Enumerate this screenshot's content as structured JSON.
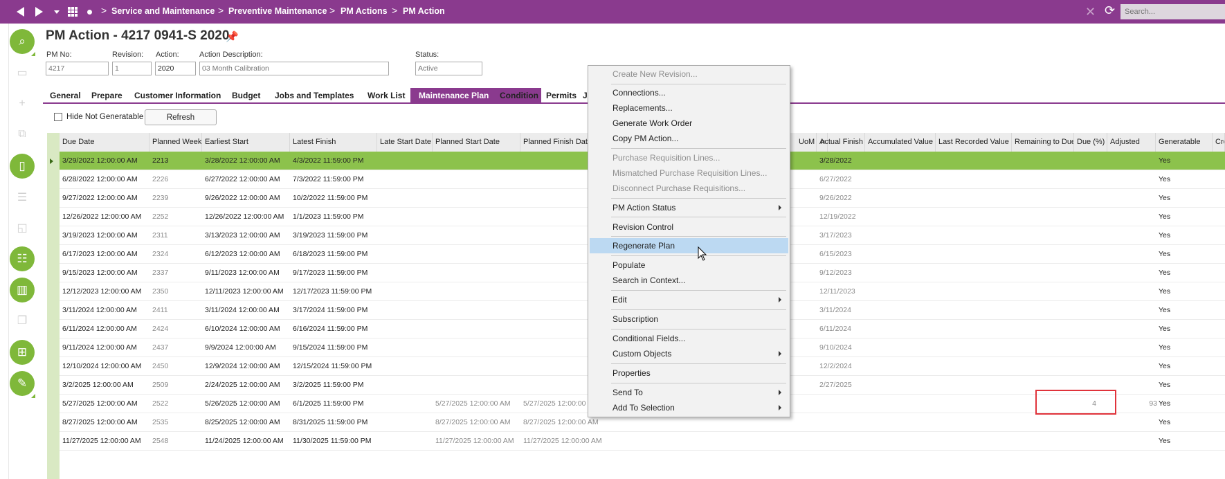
{
  "breadcrumb": [
    "Service and Maintenance",
    "Preventive Maintenance",
    "PM Actions",
    "PM Action"
  ],
  "search": {
    "placeholder": "Search..."
  },
  "page_title": "PM Action - 4217 0941-S 2020",
  "fields": {
    "pm_no": {
      "label": "PM No:",
      "value": "4217"
    },
    "revision": {
      "label": "Revision:",
      "value": "1"
    },
    "action": {
      "label": "Action:",
      "value": "2020"
    },
    "action_description": {
      "label": "Action Description:",
      "value": "03 Month Calibration"
    },
    "status": {
      "label": "Status:",
      "value": "Active"
    }
  },
  "tabs": [
    "General",
    "Prepare",
    "Customer Information",
    "Budget",
    "Jobs and Templates",
    "Work List",
    "Maintenance Plan",
    "Condition",
    "Permits",
    "J"
  ],
  "active_tab": "Maintenance Plan",
  "toolbar": {
    "hide_not_generatable": "Hide Not Generatable",
    "refresh": "Refresh"
  },
  "columns": [
    "Due Date",
    "Planned Week",
    "Earliest Start",
    "Latest Finish",
    "Late Start Date",
    "Planned Start Date",
    "Planned Finish Date",
    "n",
    "UoM",
    "Actual Finish",
    "Accumulated Value",
    "Last Recorded Value",
    "Remaining to Due",
    "Due (%)",
    "Adjusted",
    "Generatable",
    "Cre"
  ],
  "rows": [
    {
      "due": "3/29/2022 12:00:00 AM",
      "week": "2213",
      "earliest": "3/28/2022 12:00:00 AM",
      "latest": "4/3/2022 11:59:00 PM",
      "pstart": "",
      "pfinish": "",
      "actual": "3/28/2022",
      "rem": "",
      "due_pct": "",
      "gen": "Yes"
    },
    {
      "due": "6/28/2022 12:00:00 AM",
      "week": "2226",
      "earliest": "6/27/2022 12:00:00 AM",
      "latest": "7/3/2022 11:59:00 PM",
      "pstart": "",
      "pfinish": "",
      "actual": "6/27/2022",
      "rem": "",
      "due_pct": "",
      "gen": "Yes"
    },
    {
      "due": "9/27/2022 12:00:00 AM",
      "week": "2239",
      "earliest": "9/26/2022 12:00:00 AM",
      "latest": "10/2/2022 11:59:00 PM",
      "pstart": "",
      "pfinish": "",
      "actual": "9/26/2022",
      "rem": "",
      "due_pct": "",
      "gen": "Yes"
    },
    {
      "due": "12/26/2022 12:00:00 AM",
      "week": "2252",
      "earliest": "12/26/2022 12:00:00 AM",
      "latest": "1/1/2023 11:59:00 PM",
      "pstart": "",
      "pfinish": "",
      "actual": "12/19/2022",
      "rem": "",
      "due_pct": "",
      "gen": "Yes"
    },
    {
      "due": "3/19/2023 12:00:00 AM",
      "week": "2311",
      "earliest": "3/13/2023 12:00:00 AM",
      "latest": "3/19/2023 11:59:00 PM",
      "pstart": "",
      "pfinish": "",
      "actual": "3/17/2023",
      "rem": "",
      "due_pct": "",
      "gen": "Yes"
    },
    {
      "due": "6/17/2023 12:00:00 AM",
      "week": "2324",
      "earliest": "6/12/2023 12:00:00 AM",
      "latest": "6/18/2023 11:59:00 PM",
      "pstart": "",
      "pfinish": "",
      "actual": "6/15/2023",
      "rem": "",
      "due_pct": "",
      "gen": "Yes"
    },
    {
      "due": "9/15/2023 12:00:00 AM",
      "week": "2337",
      "earliest": "9/11/2023 12:00:00 AM",
      "latest": "9/17/2023 11:59:00 PM",
      "pstart": "",
      "pfinish": "",
      "actual": "9/12/2023",
      "rem": "",
      "due_pct": "",
      "gen": "Yes"
    },
    {
      "due": "12/12/2023 12:00:00 AM",
      "week": "2350",
      "earliest": "12/11/2023 12:00:00 AM",
      "latest": "12/17/2023 11:59:00 PM",
      "pstart": "",
      "pfinish": "",
      "actual": "12/11/2023",
      "rem": "",
      "due_pct": "",
      "gen": "Yes"
    },
    {
      "due": "3/11/2024 12:00:00 AM",
      "week": "2411",
      "earliest": "3/11/2024 12:00:00 AM",
      "latest": "3/17/2024 11:59:00 PM",
      "pstart": "",
      "pfinish": "",
      "actual": "3/11/2024",
      "rem": "",
      "due_pct": "",
      "gen": "Yes"
    },
    {
      "due": "6/11/2024 12:00:00 AM",
      "week": "2424",
      "earliest": "6/10/2024 12:00:00 AM",
      "latest": "6/16/2024 11:59:00 PM",
      "pstart": "",
      "pfinish": "",
      "actual": "6/11/2024",
      "rem": "",
      "due_pct": "",
      "gen": "Yes"
    },
    {
      "due": "9/11/2024 12:00:00 AM",
      "week": "2437",
      "earliest": "9/9/2024 12:00:00 AM",
      "latest": "9/15/2024 11:59:00 PM",
      "pstart": "",
      "pfinish": "",
      "actual": "9/10/2024",
      "rem": "",
      "due_pct": "",
      "gen": "Yes"
    },
    {
      "due": "12/10/2024 12:00:00 AM",
      "week": "2450",
      "earliest": "12/9/2024 12:00:00 AM",
      "latest": "12/15/2024 11:59:00 PM",
      "pstart": "",
      "pfinish": "",
      "actual": "12/2/2024",
      "rem": "",
      "due_pct": "",
      "gen": "Yes"
    },
    {
      "due": "3/2/2025 12:00:00 AM",
      "week": "2509",
      "earliest": "2/24/2025 12:00:00 AM",
      "latest": "3/2/2025 11:59:00 PM",
      "pstart": "",
      "pfinish": "",
      "actual": "2/27/2025",
      "rem": "",
      "due_pct": "",
      "gen": "Yes"
    },
    {
      "due": "5/27/2025 12:00:00 AM",
      "week": "2522",
      "earliest": "5/26/2025 12:00:00 AM",
      "latest": "6/1/2025 11:59:00 PM",
      "pstart": "5/27/2025 12:00:00 AM",
      "pfinish": "5/27/2025 12:00:00",
      "actual": "",
      "rem": "4",
      "due_pct": "93",
      "gen": "Yes"
    },
    {
      "due": "8/27/2025 12:00:00 AM",
      "week": "2535",
      "earliest": "8/25/2025 12:00:00 AM",
      "latest": "8/31/2025 11:59:00 PM",
      "pstart": "8/27/2025 12:00:00 AM",
      "pfinish": "8/27/2025 12:00:00 AM",
      "actual": "",
      "rem": "",
      "due_pct": "",
      "gen": "Yes"
    },
    {
      "due": "11/27/2025 12:00:00 AM",
      "week": "2548",
      "earliest": "11/24/2025 12:00:00 AM",
      "latest": "11/30/2025 11:59:00 PM",
      "pstart": "11/27/2025 12:00:00 AM",
      "pfinish": "11/27/2025 12:00:00 AM",
      "actual": "",
      "rem": "",
      "due_pct": "",
      "gen": "Yes"
    }
  ],
  "context_menu": {
    "items": [
      {
        "label": "Create New Revision...",
        "disabled": true
      },
      {
        "label": "Connections...",
        "disabled": false
      },
      {
        "label": "Replacements...",
        "disabled": false
      },
      {
        "label": "Generate Work Order",
        "disabled": false
      },
      {
        "label": "Copy PM Action...",
        "disabled": false
      },
      {
        "label": "Purchase Requisition Lines...",
        "disabled": true
      },
      {
        "label": "Mismatched Purchase Requisition Lines...",
        "disabled": true
      },
      {
        "label": "Disconnect Purchase Requisitions...",
        "disabled": true
      },
      {
        "label": "PM Action Status",
        "disabled": false,
        "submenu": true
      },
      {
        "label": "Revision Control",
        "disabled": false
      },
      {
        "label": "Regenerate Plan",
        "disabled": false,
        "highlighted": true
      },
      {
        "label": "Populate",
        "disabled": false
      },
      {
        "label": "Search in Context...",
        "disabled": false
      },
      {
        "label": "Edit",
        "disabled": false,
        "submenu": true
      },
      {
        "label": "Subscription",
        "disabled": false
      },
      {
        "label": "Conditional Fields...",
        "disabled": false
      },
      {
        "label": "Custom Objects",
        "disabled": false,
        "submenu": true
      },
      {
        "label": "Properties",
        "disabled": false
      },
      {
        "label": "Send To",
        "disabled": false,
        "submenu": true
      },
      {
        "label": "Add To Selection",
        "disabled": false,
        "submenu": true
      }
    ]
  },
  "colors": {
    "brand": "#8a3a8e",
    "accent_green": "#7fb83a",
    "selected_row": "#8cc24c",
    "menu_highlight": "#bcd9f2",
    "annotation_red": "#e0333b"
  }
}
